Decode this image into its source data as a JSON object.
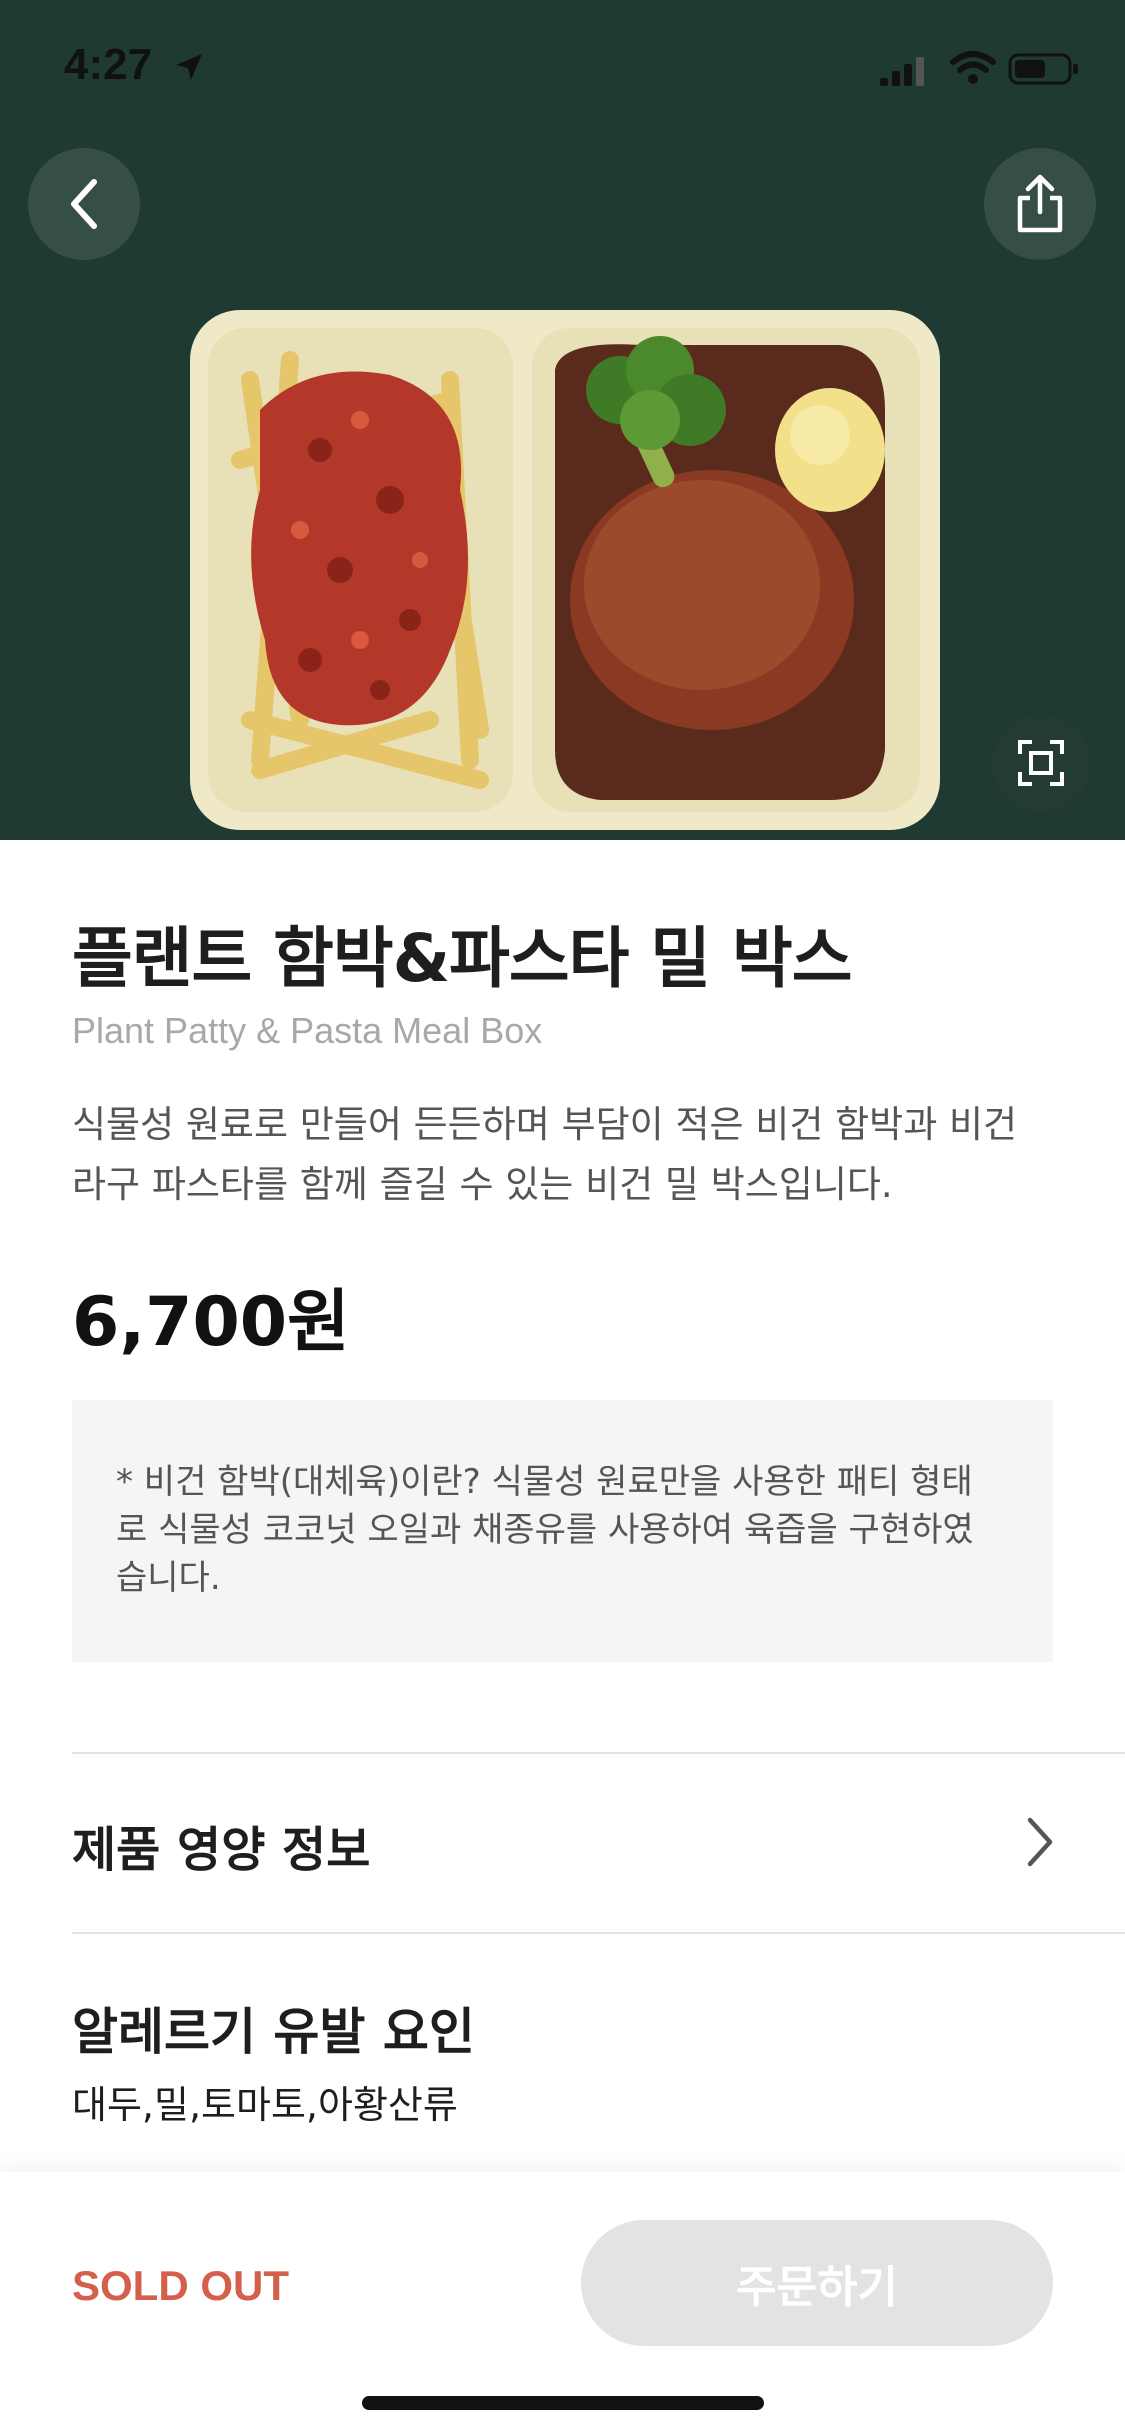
{
  "status_bar": {
    "time": "4:27"
  },
  "icons": {
    "back": "chevron-left-icon",
    "share": "share-icon",
    "expand": "expand-icon",
    "nutrition_chevron": "chevron-right-icon"
  },
  "product": {
    "title": "플랜트 함박&파스타 밀 박스",
    "subtitle": "Plant Patty & Pasta Meal Box",
    "description": "식물성 원료로 만들어 든든하며 부담이 적은 비건 함박과 비건 라구 파스타를 함께 즐길 수 있는 비건 밀 박스입니다.",
    "price": "6,700원",
    "notice": "* 비건 함박(대체육)이란? 식물성 원료만을 사용한 패티 형태로 식물성 코코넛 오일과 채종유를 사용하여 육즙을 구현하였습니다."
  },
  "nutrition": {
    "label": "제품 영양 정보"
  },
  "allergy": {
    "title": "알레르기 유발 요인",
    "values": "대두,밀,토마토,아황산류"
  },
  "bottom": {
    "status": "SOLD OUT",
    "order_label": "주문하기"
  },
  "colors": {
    "hero_bg": "#1f3a33",
    "sold_out": "#d4604c",
    "disabled_button": "#e3e3e3"
  }
}
